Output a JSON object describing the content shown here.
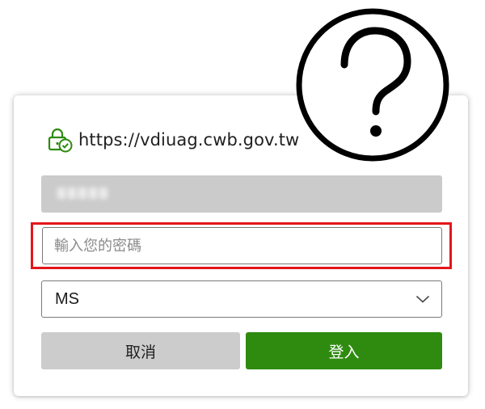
{
  "login": {
    "url": "https://vdiuag.cwb.gov.tw",
    "password_placeholder": "輸入您的密碼",
    "domain_selected": "MS",
    "cancel_label": "取消",
    "login_label": "登入"
  },
  "icons": {
    "url_icon": "lock-check-icon",
    "dropdown_icon": "chevron-down-icon",
    "overlay_icon": "help-icon"
  },
  "colors": {
    "login_button": "#2e8b10",
    "cancel_button": "#cccccc",
    "highlight_border": "#e4161b",
    "lock_icon": "#2e8b10",
    "username_field": "#cbcbcb"
  }
}
